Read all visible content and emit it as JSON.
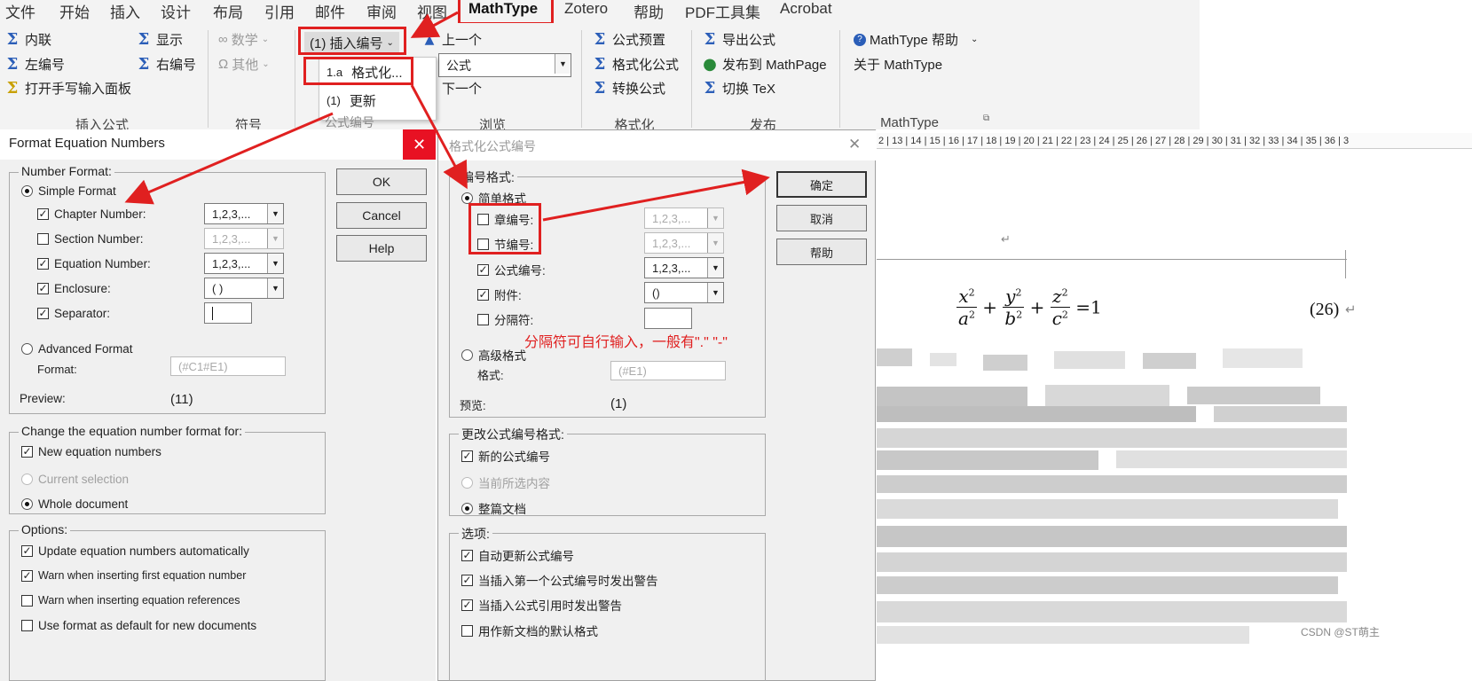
{
  "ribbon": {
    "tabs": [
      "文件",
      "开始",
      "插入",
      "设计",
      "布局",
      "引用",
      "邮件",
      "审阅",
      "视图",
      "MathType",
      "Zotero",
      "帮助",
      "PDF工具集",
      "Acrobat"
    ],
    "insert_equation_group": {
      "name": "插入公式",
      "inline": "内联",
      "display": "显示",
      "left_numbered": "左编号",
      "right_numbered": "右编号",
      "handwriting": "打开手写输入面板"
    },
    "symbols_group": {
      "name": "符号",
      "math": "数学",
      "other": "其他"
    },
    "insert_number": "(1) 插入编号",
    "browse_group": {
      "name": "浏览",
      "prev": "上一个",
      "combo_value": "公式",
      "next": "下一个"
    },
    "format_group": {
      "name": "格式化",
      "presets": "公式预置",
      "format_eq": "格式化公式",
      "convert": "转换公式"
    },
    "publish_group": {
      "name": "发布",
      "export": "导出公式",
      "publish_mathpage": "发布到 MathPage",
      "toggle_tex": "切换 TeX"
    },
    "mathtype_group": {
      "name": "MathType",
      "help": "MathType 帮助",
      "about": "关于 MathType"
    },
    "menu": {
      "format_icon": "1.a",
      "format_label": "格式化...",
      "update_icon": "(1)",
      "update_label": "更新",
      "behind_text": "公式编号"
    }
  },
  "dialog_en": {
    "title": "Format Equation Numbers",
    "number_format": "Number Format:",
    "simple_format": "Simple Format",
    "chapter_number": "Chapter Number:",
    "section_number": "Section Number:",
    "equation_number": "Equation Number:",
    "enclosure": "Enclosure:",
    "separator": "Separator:",
    "chapter_value": "1,2,3,...",
    "section_value": "1,2,3,...",
    "equation_value": "1,2,3,...",
    "enclosure_value": "( )",
    "advanced_format": "Advanced Format",
    "format_label": "Format:",
    "format_placeholder": "(#C1#E1)",
    "preview_label": "Preview:",
    "preview_value": "(11)",
    "change_for": "Change the equation number format for:",
    "new_numbers": "New equation numbers",
    "current_selection": "Current selection",
    "whole_document": "Whole document",
    "options": "Options:",
    "opt_update": "Update equation numbers automatically",
    "opt_warn_first": "Warn when inserting first equation number",
    "opt_warn_refs": "Warn when inserting equation references",
    "opt_default": "Use format as default for new documents",
    "ok": "OK",
    "cancel": "Cancel",
    "help": "Help"
  },
  "dialog_cn": {
    "title": "格式化公式编号",
    "number_format": "编号格式:",
    "simple_format": "简单格式",
    "chapter_number": "章编号:",
    "section_number": "节编号:",
    "equation_number": "公式编号:",
    "enclosure": "附件:",
    "separator": "分隔符:",
    "chapter_value": "1,2,3,...",
    "section_value": "1,2,3,...",
    "equation_value": "1,2,3,...",
    "enclosure_value": "()",
    "advanced_format": "高级格式",
    "format_label": "格式:",
    "format_placeholder": "(#E1)",
    "preview_label": "预览:",
    "preview_value": "(1)",
    "change_for": "更改公式编号格式:",
    "new_numbers": "新的公式编号",
    "current_selection": "当前所选内容",
    "whole_document": "整篇文档",
    "options": "选项:",
    "opt_update": "自动更新公式编号",
    "opt_warn_first": "当插入第一个公式编号时发出警告",
    "opt_warn_refs": "当插入公式引用时发出警告",
    "opt_default": "用作新文档的默认格式",
    "ok": "确定",
    "cancel": "取消",
    "help": "帮助"
  },
  "annotation": "分隔符可自行输入，一般有\".\" \"-\"",
  "document": {
    "ruler": "2 | 13 | 14 | 15 | 16 | 17 | 18 | 19 | 20 | 21 | 22 | 23 | 24 | 25 | 26 | 27 | 28 | 29 | 30 | 31 | 32 | 33 | 34 | 35 | 36 | 3",
    "eq_number": "(26)",
    "watermark": "CSDN @ST萌主",
    "paragraph_mark": "↵"
  },
  "colors": {
    "accent_red": "#e02020",
    "ribbon_bg": "#f3f3f3",
    "dialog_bg": "#f0f0f0",
    "icon_blue": "#2b5eb8"
  }
}
